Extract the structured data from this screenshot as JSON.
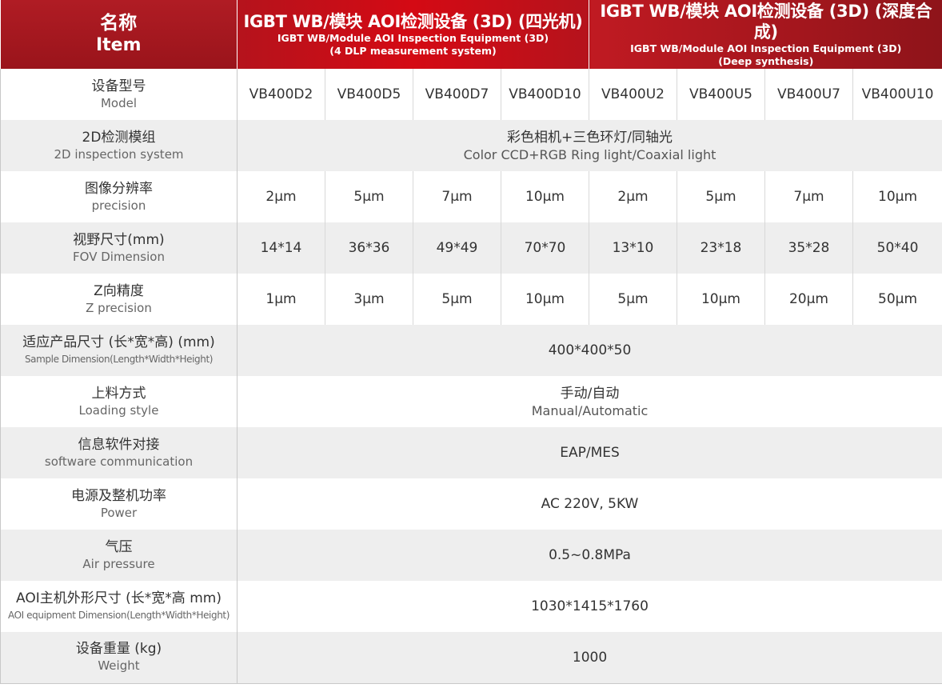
{
  "header": {
    "item_cn": "名称",
    "item_en": "Item",
    "group_a": {
      "title": "IGBT WB/模块 AOI检测设备 (3D) (四光机)",
      "sub1": "IGBT WB/Module AOI Inspection Equipment (3D)",
      "sub2": "(4 DLP measurement system)"
    },
    "group_b": {
      "title": "IGBT WB/模块 AOI检测设备 (3D) (深度合成)",
      "sub1": "IGBT WB/Module AOI Inspection Equipment (3D)",
      "sub2": "(Deep synthesis)"
    }
  },
  "rows": {
    "model": {
      "cn": "设备型号",
      "en": "Model",
      "values": [
        "VB400D2",
        "VB400D5",
        "VB400D7",
        "VB400D10",
        "VB400U2",
        "VB400U5",
        "VB400U7",
        "VB400U10"
      ]
    },
    "inspection2d": {
      "cn": "2D检测模组",
      "en": "2D inspection system",
      "value_cn": "彩色相机+三色环灯/同轴光",
      "value_en": "Color CCD+RGB Ring light/Coaxial light"
    },
    "precision": {
      "cn": "图像分辨率",
      "en": "precision",
      "values": [
        "2µm",
        "5µm",
        "7µm",
        "10µm",
        "2µm",
        "5µm",
        "7µm",
        "10µm"
      ]
    },
    "fov": {
      "cn": "视野尺寸(mm)",
      "en": "FOV Dimension",
      "values": [
        "14*14",
        "36*36",
        "49*49",
        "70*70",
        "13*10",
        "23*18",
        "35*28",
        "50*40"
      ]
    },
    "zprecision": {
      "cn": "Z向精度",
      "en": "Z precision",
      "values": [
        "1µm",
        "3µm",
        "5µm",
        "10µm",
        "5µm",
        "10µm",
        "20µm",
        "50µm"
      ]
    },
    "sample": {
      "cn": "适应产品尺寸 (长*宽*高) (mm)",
      "en": "Sample Dimension(Length*Width*Height)",
      "value": "400*400*50"
    },
    "loading": {
      "cn": "上料方式",
      "en": "Loading style",
      "value_cn": "手动/自动",
      "value_en": "Manual/Automatic"
    },
    "software": {
      "cn": "信息软件对接",
      "en": "software communication",
      "value": "EAP/MES"
    },
    "power": {
      "cn": "电源及整机功率",
      "en": "Power",
      "value": "AC 220V, 5KW"
    },
    "air": {
      "cn": "气压",
      "en": "Air pressure",
      "value": "0.5~0.8MPa"
    },
    "dimension": {
      "cn": "AOI主机外形尺寸 (长*宽*高 mm)",
      "en": "AOI equipment Dimension(Length*Width*Height)",
      "value": "1030*1415*1760"
    },
    "weight": {
      "cn": "设备重量 (kg)",
      "en": "Weight",
      "value": "1000"
    }
  }
}
